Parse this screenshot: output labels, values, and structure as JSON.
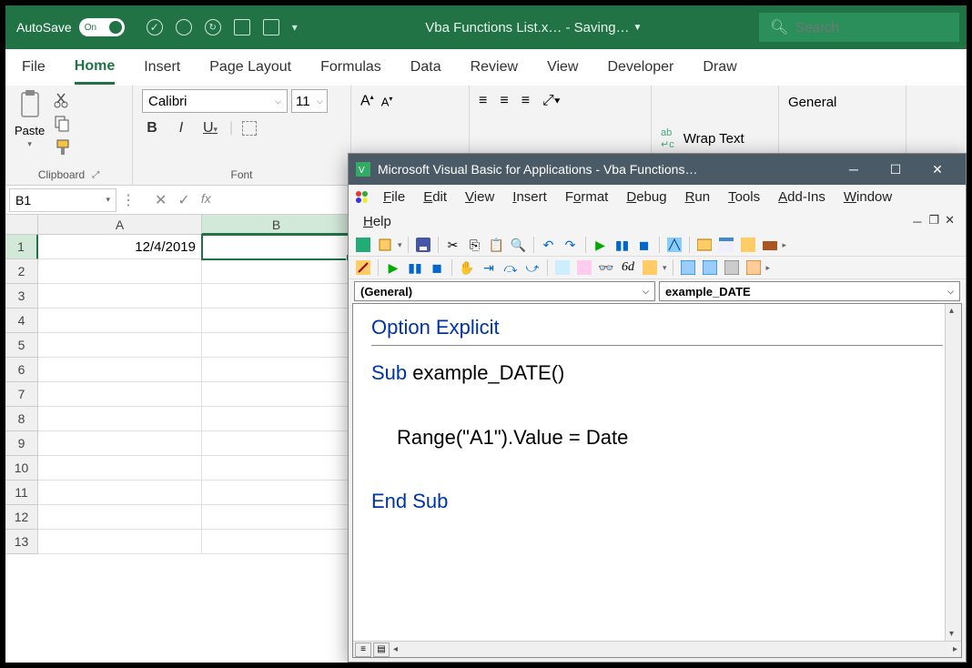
{
  "titlebar": {
    "autosave_label": "AutoSave",
    "toggle_text": "On",
    "doc_title": "Vba Functions List.x…  -  Saving…",
    "search_placeholder": "Search"
  },
  "ribbon": {
    "tabs": [
      "File",
      "Home",
      "Insert",
      "Page Layout",
      "Formulas",
      "Data",
      "Review",
      "View",
      "Developer",
      "Draw"
    ],
    "active": "Home",
    "clipboard": {
      "paste_label": "Paste",
      "group_label": "Clipboard"
    },
    "font": {
      "name": "Calibri",
      "size": "11",
      "group_label": "Font",
      "bold": "B",
      "italic": "I",
      "underline": "U"
    },
    "alignment": {
      "wrap_text": "Wrap Text"
    },
    "number": {
      "format": "General"
    }
  },
  "formula_bar": {
    "name_box": "B1",
    "fx_label": "fx"
  },
  "grid": {
    "columns": [
      "A",
      "B"
    ],
    "rows": [
      "1",
      "2",
      "3",
      "4",
      "5",
      "6",
      "7",
      "8",
      "9",
      "10",
      "11",
      "12",
      "13"
    ],
    "cells": {
      "A1": "12/4/2019"
    },
    "selected": "B1"
  },
  "vba": {
    "title": "Microsoft Visual Basic for Applications - Vba Functions…",
    "menus": [
      "File",
      "Edit",
      "View",
      "Insert",
      "Format",
      "Debug",
      "Run",
      "Tools",
      "Add-Ins",
      "Window",
      "Help"
    ],
    "dropdown_left": "(General)",
    "dropdown_right": "example_DATE",
    "code": {
      "line1_kw": "Option Explicit",
      "line2_kw": "Sub",
      "line2_rest": " example_DATE()",
      "line3": "Range(\"A1\").Value = Date",
      "line4_kw": "End Sub"
    }
  }
}
